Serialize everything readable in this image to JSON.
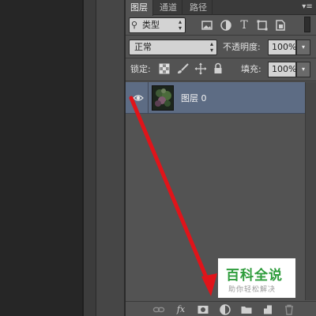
{
  "panel": {
    "tabs": [
      "图层",
      "通道",
      "路径"
    ],
    "menu_icon": "panel-menu-icon"
  },
  "filter_row": {
    "kind_label": "类型",
    "filter_icons": [
      "image-filter-icon",
      "adjustment-filter-icon",
      "type-filter-icon",
      "shape-filter-icon",
      "smart-object-filter-icon"
    ]
  },
  "blend_row": {
    "blend_mode": "正常",
    "opacity_label": "不透明度:",
    "opacity_value": "100%"
  },
  "lock_row": {
    "lock_label": "锁定:",
    "lock_icons": [
      "lock-transparent-icon",
      "lock-paint-icon",
      "lock-move-icon",
      "lock-all-icon"
    ],
    "fill_label": "填充:",
    "fill_value": "100%"
  },
  "layers": [
    {
      "name": "图层 0",
      "visible": true,
      "selected": true
    }
  ],
  "bottom_bar": {
    "icons": [
      "link-layers-icon",
      "fx-icon",
      "add-mask-icon",
      "adjustment-layer-icon",
      "new-group-icon",
      "new-layer-icon",
      "delete-layer-icon"
    ],
    "fx_text": "fx"
  },
  "watermark": {
    "title": "百科全说",
    "subtitle": "助你轻松解决"
  },
  "colors": {
    "selected_layer": "#5d6c84",
    "arrow": "#e0141a",
    "watermark_green": "#2e9c3c"
  }
}
